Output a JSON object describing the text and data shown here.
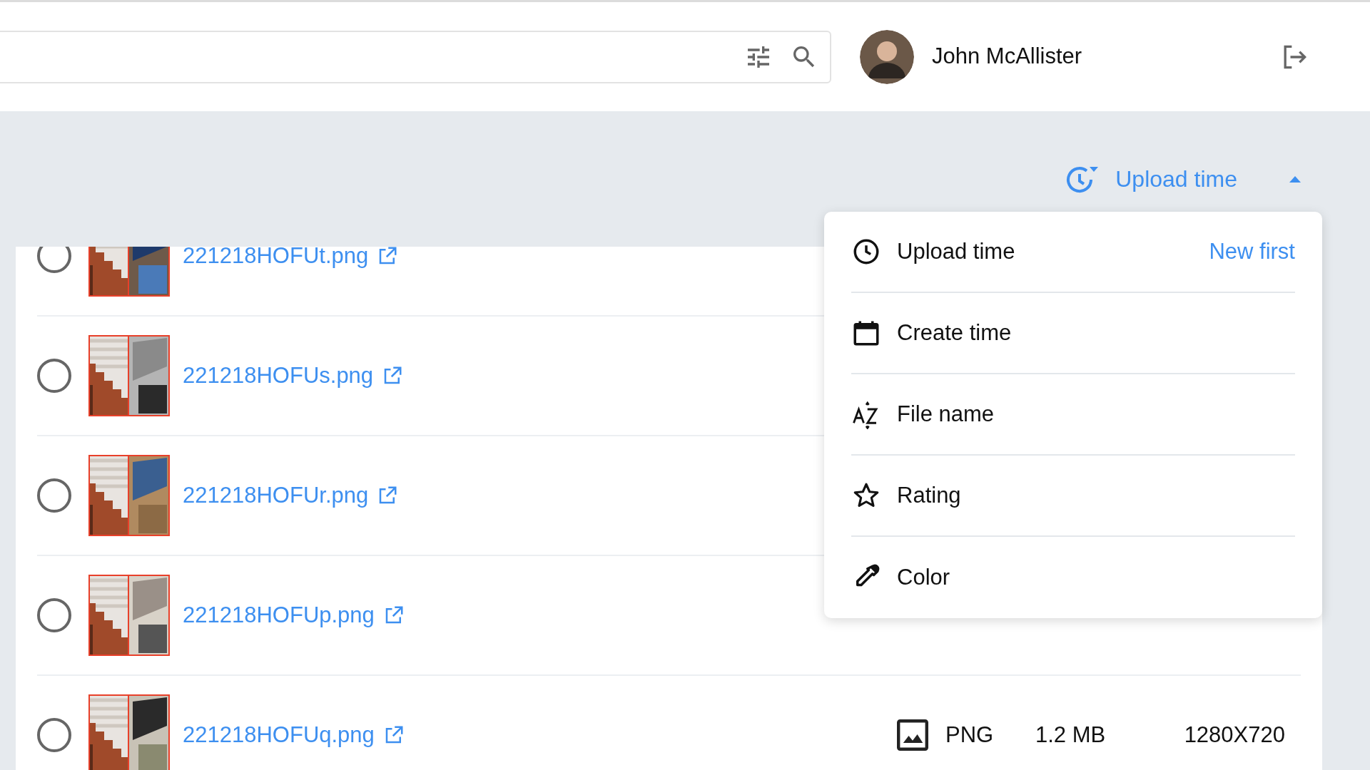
{
  "user": {
    "name": "John McAllister"
  },
  "sort": {
    "label": "Upload time",
    "expanded": true
  },
  "sort_menu": [
    {
      "kind": "clock",
      "label": "Upload time",
      "order": "New first"
    },
    {
      "kind": "calendar",
      "label": "Create time"
    },
    {
      "kind": "alpha",
      "label": "File name"
    },
    {
      "kind": "star",
      "label": "Rating"
    },
    {
      "kind": "dropper",
      "label": "Color"
    }
  ],
  "files": [
    {
      "name": "221218HOFUt.png",
      "selected": false
    },
    {
      "name": "221218HOFUs.png",
      "selected": false
    },
    {
      "name": "221218HOFUr.png",
      "selected": false
    },
    {
      "name": "221218HOFUp.png",
      "selected": false
    },
    {
      "name": "221218HOFUq.png",
      "selected": false,
      "type": "PNG",
      "size": "1.2 MB",
      "dimensions": "1280X720"
    }
  ]
}
